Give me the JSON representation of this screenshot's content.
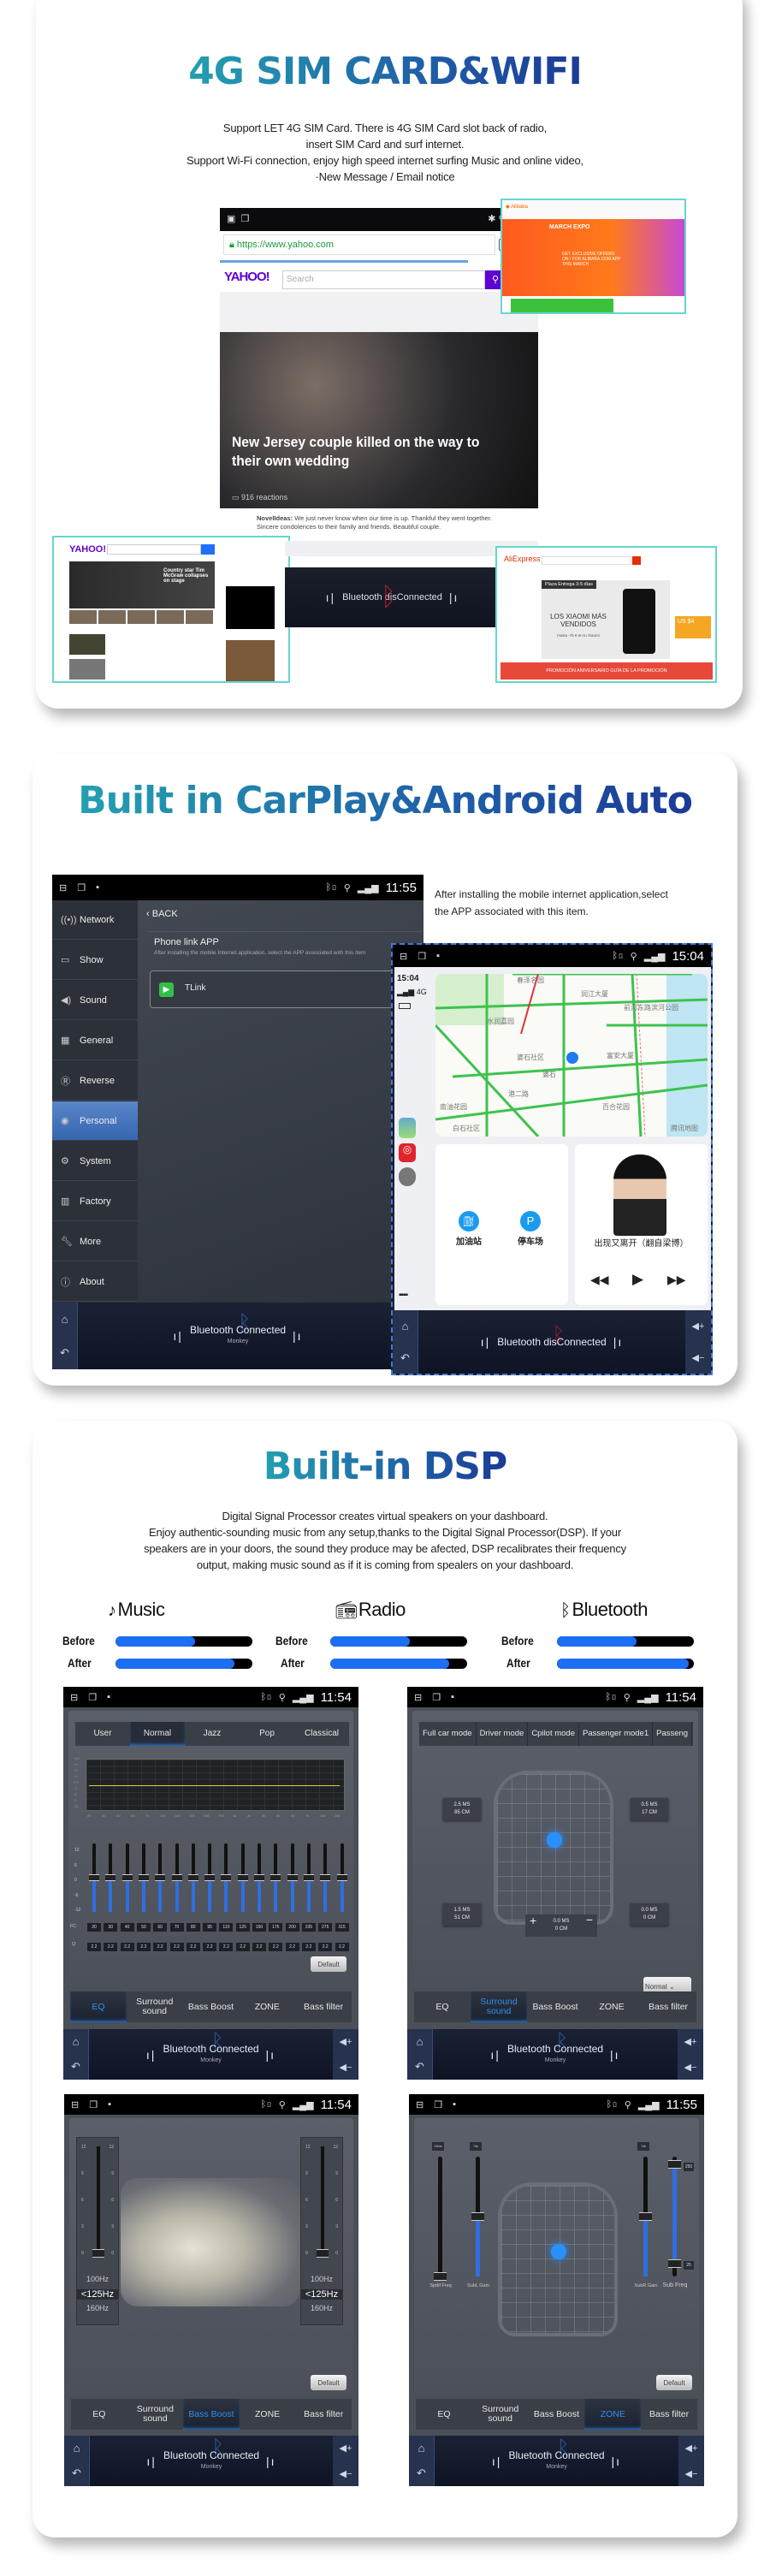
{
  "sim": {
    "title": "4G SIM CARD&WIFI",
    "paragraphs": [
      "Support LET 4G SIM Card. There is 4G SIM Card slot back of radio,",
      "insert SIM Card and surf internet.",
      "Support Wi-Fi connection, enjoy high speed internet surfing Music and online video,",
      "·New Message / Email notice"
    ],
    "browser": {
      "url": "https://www.yahoo.com",
      "logo": "YAHOO!",
      "search_placeholder": "Search",
      "headline": "New Jersey couple killed on the way to their own wedding",
      "reactions": "916 reactions",
      "comment_author": "NovelIdeas:",
      "comment_text": "We just never know when our time is up. Thankful they went together. Sincere condolences to their family and friends. Beautiful couple."
    },
    "yahoo_inset": {
      "logo": "YAHOO!",
      "story": "Country star Tim McGraw collapses on stage"
    },
    "ali_top": {
      "banner": "MARCH EXPO",
      "offer": "GET EXCLUSIVE OFFERS ON / FOR ALIBABA.COM APP THIS MARCH"
    },
    "ali_bottom": {
      "logo": "AliExpress",
      "plaza": "Plaza  Entrega 3-5 días",
      "promo": "LOS XIAOMI MÁS VENDIDOS",
      "promo_sub": "Hasta -75 € en tu Xiaomi",
      "price": "US $4",
      "banner": "PROMOCIÓN ANIVERSARIO   GUÍA DE LA PROMOCIÓN"
    },
    "bt_status": "Bluetooth disConnected"
  },
  "carplay": {
    "title": "Built in CarPlay&Android Auto",
    "description": [
      "After installing the mobile internet application,select",
      "the APP associated with this item."
    ],
    "settings": {
      "time": "11:55",
      "back": "BACK",
      "menu": [
        {
          "label": "Network",
          "icon": "antenna"
        },
        {
          "label": "Show",
          "icon": "display"
        },
        {
          "label": "Sound",
          "icon": "speaker"
        },
        {
          "label": "General",
          "icon": "grid"
        },
        {
          "label": "Reverse",
          "icon": "reverse"
        },
        {
          "label": "Personal",
          "icon": "person"
        },
        {
          "label": "System",
          "icon": "gears"
        },
        {
          "label": "Factory",
          "icon": "factory"
        },
        {
          "label": "More",
          "icon": "wrench"
        },
        {
          "label": "About",
          "icon": "info"
        }
      ],
      "active": "Personal",
      "phone_link_title": "Phone link APP",
      "phone_link_desc": "After installing the mobile Internet application, select the APP associated with this item",
      "app": "TLink",
      "bt": "Bluetooth Connected",
      "bt_device": "Monkey"
    },
    "carplay_screen": {
      "time": "15:04",
      "side_time": "15:04",
      "network": "4G",
      "map_labels": [
        "春泽名园",
        "润江大厦",
        "前河东路滨河公园",
        "水润嘉园",
        "婆石社区",
        "婆石",
        "富安大厦",
        "南油花园",
        "百合花园",
        "港二路",
        "白石社区",
        "腾讯地图"
      ],
      "shortcuts": [
        "加油站",
        "停车场"
      ],
      "song": "出现又离开（翻自梁博）",
      "bt": "Bluetooth disConnected"
    }
  },
  "dsp": {
    "title": "Built-in DSP",
    "paragraphs": [
      "Digital Signal Processor creates virtual speakers on your dashboard.",
      "Enjoy authentic-sounding music from any setup,thanks to the Digital Signal Processor(DSP). If your",
      "speakers are in your doors, the sound they produce may be afected, DSP recalibrates their frequency",
      "output, making music sound as if it is coming from spealers on your dashboard."
    ],
    "before_label": "Before",
    "after_label": "After",
    "comparisons": [
      {
        "label": "Music",
        "icon": "music-note",
        "before": 0.58,
        "after": 0.87
      },
      {
        "label": "Radio",
        "icon": "radio",
        "before": 0.58,
        "after": 0.87
      },
      {
        "label": "Bluetooth",
        "icon": "bluetooth",
        "before": 0.58,
        "after": 0.96
      }
    ],
    "bottom_tabs": [
      "EQ",
      "Surround sound",
      "Bass Boost",
      "ZONE",
      "Bass filter"
    ],
    "bt": "Bluetooth Connected",
    "bt_device": "Monkey",
    "default": "Default",
    "eq": {
      "time": "11:54",
      "presets": [
        "User",
        "Normal",
        "Jazz",
        "Pop",
        "Classical"
      ],
      "active_preset": "Normal",
      "graph_y": [
        "+12",
        "+9",
        "+6",
        "+3",
        "0.0",
        "-3",
        "-6",
        "-9",
        "-12"
      ],
      "graph_x": [
        "20",
        "30",
        "40",
        "50",
        "70",
        "100",
        "100",
        "100",
        "500",
        "700",
        "1k",
        "2k",
        "3k",
        "4k",
        "5k",
        "7k",
        "10k",
        "20k"
      ],
      "slider_scale": [
        "12",
        "6",
        "0",
        "-6",
        "-12"
      ],
      "fc_label": "FC:",
      "fc": [
        "20",
        "30",
        "40",
        "50",
        "60",
        "70",
        "80",
        "95",
        "110",
        "125",
        "150",
        "175",
        "200",
        "235",
        "275",
        "315"
      ],
      "q_label": "Q:",
      "q": [
        "2.2",
        "2.2",
        "2.2",
        "2.2",
        "2.2",
        "2.2",
        "2.2",
        "2.2",
        "2.2",
        "2.2",
        "2.2",
        "2.2",
        "2.2",
        "2.2",
        "2.2",
        "2.2"
      ],
      "gains_db": [
        0,
        0,
        0,
        0,
        0,
        0,
        0,
        0,
        0,
        0,
        0,
        0,
        0,
        0,
        0,
        0
      ]
    },
    "surround": {
      "time": "11:54",
      "modes": [
        "Full car mode",
        "Driver mode",
        "Cpilot mode",
        "Passenger mode1",
        "Passeng"
      ],
      "delays": [
        [
          "2.5 MS",
          "85 CM"
        ],
        [
          "0.5 MS",
          "17 CM"
        ],
        [
          "1.5 MS",
          "51 CM"
        ],
        [
          "0.0 MS",
          "0 CM"
        ]
      ],
      "center": [
        "0.0 MS",
        "0 CM"
      ],
      "preset": "Normal"
    },
    "bass": {
      "time": "11:54",
      "scale": [
        "12",
        "9",
        "6",
        "3",
        "0"
      ],
      "freqs": [
        "100Hz",
        "<125Hz",
        "160Hz"
      ],
      "gain": [
        0,
        0
      ]
    },
    "zone": {
      "time": "11:55",
      "sliders": [
        {
          "label": "Spdif Freq",
          "tag": "24bits",
          "level": 0
        },
        {
          "label": "SubL Gain",
          "tag": "7db",
          "level": 0.5
        },
        {
          "label": "SubR Gain",
          "tag": "7db",
          "level": 0.5
        },
        {
          "label": "Sub Freq",
          "top": "250",
          "bottom": "25"
        }
      ]
    }
  }
}
